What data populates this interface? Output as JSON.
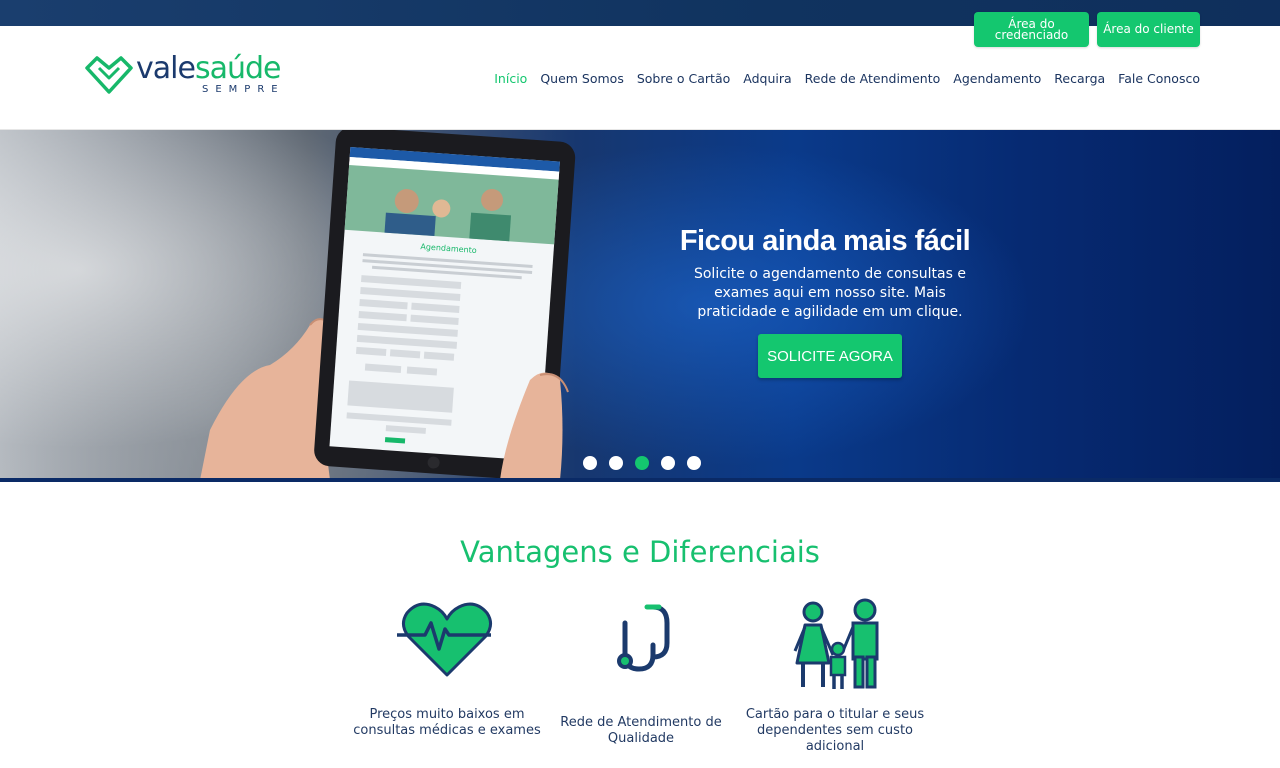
{
  "header": {
    "credenciado_button": "Área do credenciado",
    "cliente_button": "Área do cliente",
    "logo": {
      "brand_vale": "vale",
      "brand_saude": "saúde",
      "sub": "SEMPRE"
    },
    "nav": [
      "Início",
      "Quem Somos",
      "Sobre o Cartão",
      "Adquira",
      "Rede de Atendimento",
      "Agendamento",
      "Recarga",
      "Fale Conosco"
    ],
    "active_nav": "Início"
  },
  "hero": {
    "title": "Ficou ainda mais fácil",
    "text": "Solicite o agendamento de consultas e exames aqui em nosso site. Mais praticidade e agilidade em um clique.",
    "cta": "SOLICITE AGORA",
    "tablet_heading": "Agendamento",
    "slides": 5,
    "active_slide": 3
  },
  "section": {
    "title": "Vantagens e Diferenciais",
    "features": [
      {
        "icon": "heart-pulse-icon",
        "text": "Preços muito baixos em consultas médicas e exames"
      },
      {
        "icon": "stethoscope-icon",
        "text": "Rede de Atendimento de Qualidade"
      },
      {
        "icon": "family-icon",
        "text": "Cartão para o titular e seus dependentes sem custo adicional"
      }
    ]
  },
  "colors": {
    "accent": "#14c76f",
    "navy": "#1b3a6d",
    "topbar": "#10335f"
  }
}
